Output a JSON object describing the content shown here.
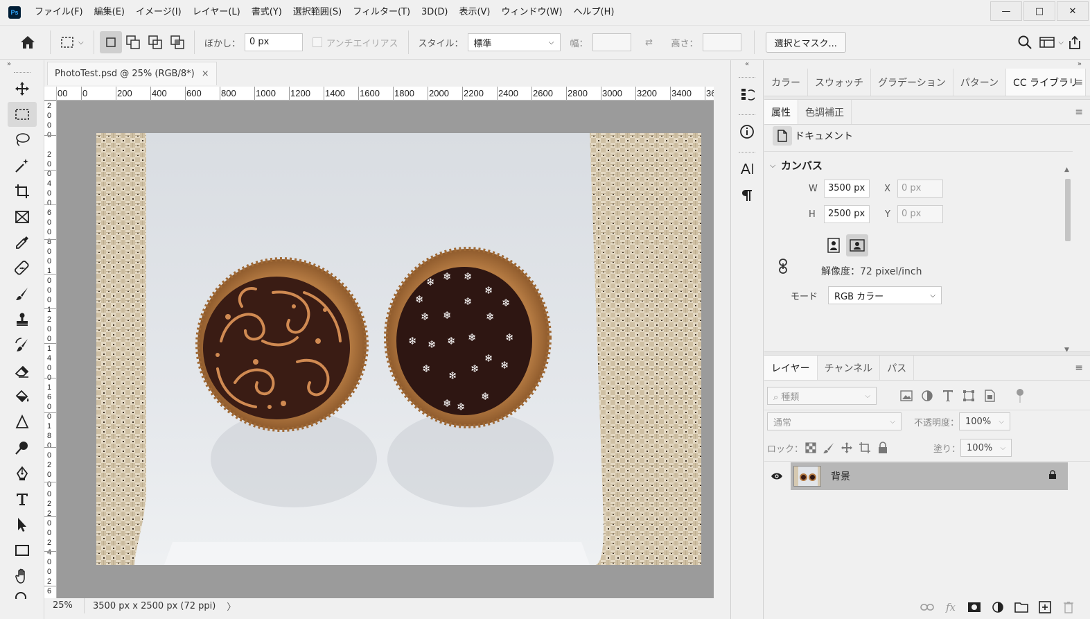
{
  "app": {
    "logo_text": "Ps",
    "menu": [
      "ファイル(F)",
      "編集(E)",
      "イメージ(I)",
      "レイヤー(L)",
      "書式(Y)",
      "選択範囲(S)",
      "フィルター(T)",
      "3D(D)",
      "表示(V)",
      "ウィンドウ(W)",
      "ヘルプ(H)"
    ]
  },
  "window_controls": {
    "minimize": "—",
    "maximize": "□",
    "close": "✕"
  },
  "options": {
    "feather_label": "ぼかし：",
    "feather_value": "0 px",
    "antialias_label": "アンチエイリアス",
    "style_label": "スタイル：",
    "style_value": "標準",
    "width_label": "幅：",
    "height_label": "高さ：",
    "select_mask_button": "選択とマスク..."
  },
  "document": {
    "tab_title": "PhotoTest.psd @ 25% (RGB/8*)",
    "tab_close": "×",
    "ruler_top": [
      "00",
      "0",
      "200",
      "400",
      "600",
      "800",
      "1000",
      "1200",
      "1400",
      "1600",
      "1800",
      "2000",
      "2200",
      "2400",
      "2600",
      "2800",
      "3000",
      "3200",
      "3400",
      "36"
    ],
    "ruler_left": [
      "2",
      "0",
      "0",
      "0",
      "",
      "2",
      "0",
      "0",
      "4",
      "0",
      "0",
      "6",
      "0",
      "0",
      "8",
      "0",
      "0",
      "1",
      "0",
      "0",
      "0",
      "1",
      "2",
      "0",
      "0",
      "1",
      "4",
      "0",
      "0",
      "1",
      "6",
      "0",
      "0",
      "1",
      "8",
      "0",
      "0",
      "2",
      "0",
      "0",
      "0",
      "2",
      "2",
      "0",
      "0",
      "2",
      "4",
      "0",
      "0",
      "2",
      "6"
    ],
    "zoom": "25%",
    "status_info": "3500 px x 2500 px (72 ppi)",
    "status_arrow": "〉"
  },
  "panels": {
    "top_tabs": [
      "カラー",
      "スウォッチ",
      "グラデーション",
      "パターン",
      "CC ライブラリ"
    ],
    "top_active": 4,
    "prop_tabs": [
      "属性",
      "色調補正"
    ],
    "prop_active": 0,
    "document_label": "ドキュメント",
    "canvas_section": "カンバス",
    "w_label": "W",
    "w_value": "3500 px",
    "h_label": "H",
    "h_value": "2500 px",
    "x_label": "X",
    "x_value": "0 px",
    "y_label": "Y",
    "y_value": "0 px",
    "resolution": "解像度：72 pixel/inch",
    "mode_label": "モード",
    "mode_value": "RGB カラー",
    "layer_tabs": [
      "レイヤー",
      "チャンネル",
      "パス"
    ],
    "layer_active": 0,
    "kind_placeholder": "種類",
    "blend_mode": "通常",
    "opacity_label": "不透明度：",
    "opacity_value": "100%",
    "lock_label": "ロック：",
    "fill_label": "塗り：",
    "fill_value": "100%",
    "layer_name": "背景"
  },
  "colors": {
    "accent_bg": "#001e36",
    "accent_fg": "#31a8ff",
    "canvas_gray": "#9b9b9b",
    "layer_selected": "#b7b7b7"
  }
}
